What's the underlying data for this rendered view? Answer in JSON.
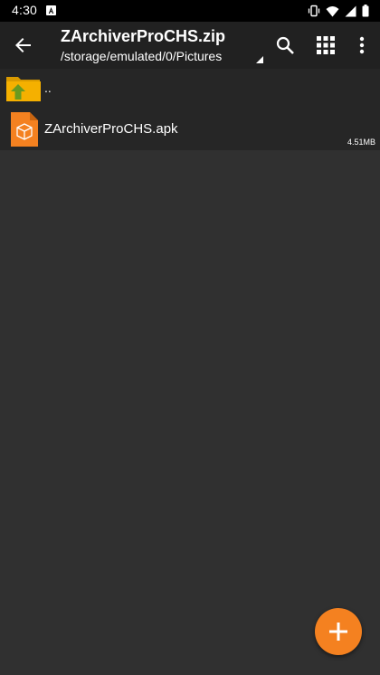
{
  "status_bar": {
    "time": "4:30",
    "icons": [
      "notification-a-icon",
      "vibrate-icon",
      "wifi-icon",
      "cellular-signal-icon",
      "battery-icon"
    ]
  },
  "app_bar": {
    "title": "ZArchiverProCHS.zip",
    "path": "/storage/emulated/0/Pictures",
    "actions": [
      "search-icon",
      "grid-view-icon",
      "more-vertical-icon"
    ]
  },
  "files": [
    {
      "name": "..",
      "type": "parent-folder",
      "icon": "folder-up-icon",
      "size": ""
    },
    {
      "name": "ZArchiverProCHS.apk",
      "type": "apk",
      "icon": "apk-file-icon",
      "size": "4.51MB"
    }
  ],
  "fab": {
    "icon": "plus-icon"
  },
  "colors": {
    "status_bar": "#000000",
    "app_bar": "#212121",
    "list_bg": "#262626",
    "screen_bg": "#303030",
    "accent": "#f48120",
    "folder": "#f5b000",
    "folder_arrow": "#6a9a1f"
  }
}
